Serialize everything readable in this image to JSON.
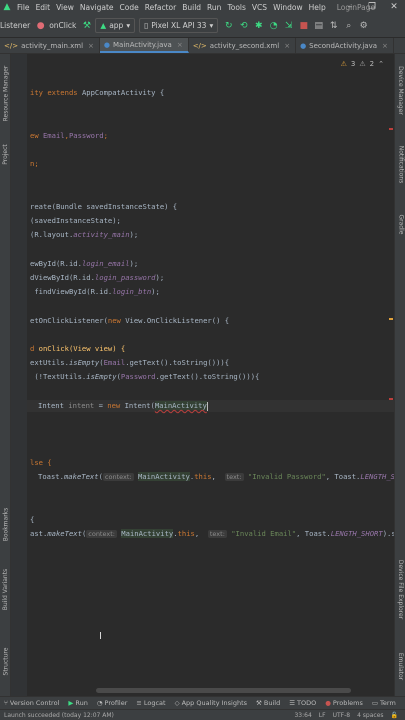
{
  "menubar": {
    "items": [
      "File",
      "Edit",
      "View",
      "Navigate",
      "Code",
      "Refactor",
      "Build",
      "Run",
      "Tools",
      "VCS",
      "Window",
      "Help"
    ],
    "project_title": "LoginPage"
  },
  "toolbar": {
    "listener_label": "Listener",
    "onclick_label": "onClick",
    "app_config": "app",
    "device": "Pixel XL API 33"
  },
  "tabs": [
    {
      "label": "activity_main.xml"
    },
    {
      "label": "MainActivity.java"
    },
    {
      "label": "activity_second.xml"
    },
    {
      "label": "SecondActivity.java"
    }
  ],
  "inspection": {
    "warnings": "3",
    "weak_warnings": "2"
  },
  "left_tool_windows": [
    "Resource Manager",
    "Project",
    "Bookmarks",
    "Build Variants",
    "Structure"
  ],
  "right_tool_windows": [
    "Device Manager",
    "Notifications",
    "Gradle",
    "Device File Explorer",
    "Emulator"
  ],
  "code": {
    "l1a": "ity ",
    "l1b": "extends ",
    "l1c": "AppCompatActivity {",
    "l2a": "ew ",
    "l2b": "Email",
    "l2c": ",",
    "l2d": "Password",
    "l2e": ";",
    "l3": "n;",
    "l4a": "reate(Bundle savedInstanceState) {",
    "l5": "(savedInstanceState);",
    "l6a": "(R.layout.",
    "l6b": "activity_main",
    "l6c": ");",
    "l7a": "ewById(R.id.",
    "l7b": "login_email",
    "l7c": ");",
    "l8a": "dViewById(R.id.",
    "l8b": "login_password",
    "l8c": ");",
    "l9a": " findViewById(R.id.",
    "l9b": "login_btn",
    "l9c": ");",
    "l10a": "etOnClickListener(",
    "l10b": "new ",
    "l10c": "View.OnClickListener() {",
    "l11a": "d ",
    "l11b": "onClick(View view) {",
    "l12a": "extUtils.",
    "l12b": "isEmpty",
    "l12c": "(",
    "l12d": "Email",
    "l12e": ".getText().toString())){",
    "l13a": " (!TextUtils.",
    "l13b": "isEmpty",
    "l13c": "(",
    "l13d": "Password",
    "l13e": ".getText().toString())){",
    "l14a": "Intent ",
    "l14b": "intent",
    "l14c": " = ",
    "l14d": "new ",
    "l14e": "Intent(",
    "l14f": "MainActivity",
    "l15": "lse {",
    "l16a": "Toast.",
    "l16b": "makeText",
    "l16c": "(",
    "l16hint": "context:",
    "l16d": "MainActivity",
    "l16e": ".",
    "l16f": "this",
    "l16g": ", ",
    "l16hint2": "text:",
    "l16h": "\"Invalid Password\"",
    "l16i": ", Toast.",
    "l16j": "LENGTH_SHOR",
    "l17": "{",
    "l18a": "ast.",
    "l18b": "makeText",
    "l18c": "(",
    "l18hint": "context:",
    "l18d": "MainActivity",
    "l18e": ".",
    "l18f": "this",
    "l18g": ", ",
    "l18hint2": "text:",
    "l18h": "\"Invalid Email\"",
    "l18i": ", Toast.",
    "l18j": "LENGTH_SHORT",
    "l18k": ").show"
  },
  "bottom_tools": [
    {
      "icon": "git-icon",
      "label": "Version Control"
    },
    {
      "icon": "run-icon",
      "label": "Run"
    },
    {
      "icon": "profiler-icon",
      "label": "Profiler"
    },
    {
      "icon": "logcat-icon",
      "label": "Logcat"
    },
    {
      "icon": "app-quality-icon",
      "label": "App Quality Insights"
    },
    {
      "icon": "build-icon",
      "label": "Build"
    },
    {
      "icon": "todo-icon",
      "label": "TODO"
    },
    {
      "icon": "problems-icon",
      "label": "Problems"
    },
    {
      "icon": "terminal-icon",
      "label": "Term"
    }
  ],
  "status": {
    "message": "Launch succeeded (today 12:07 AM)",
    "position": "33:64",
    "line_sep": "LF",
    "encoding": "UTF-8",
    "indent": "4 spaces"
  },
  "colors": {
    "background": "#2b2b2b",
    "keyword": "#cc7832",
    "field": "#9876aa",
    "method": "#ffc66d",
    "string": "#6a8759",
    "accent": "#4a88c7",
    "android_green": "#3ddc84"
  }
}
